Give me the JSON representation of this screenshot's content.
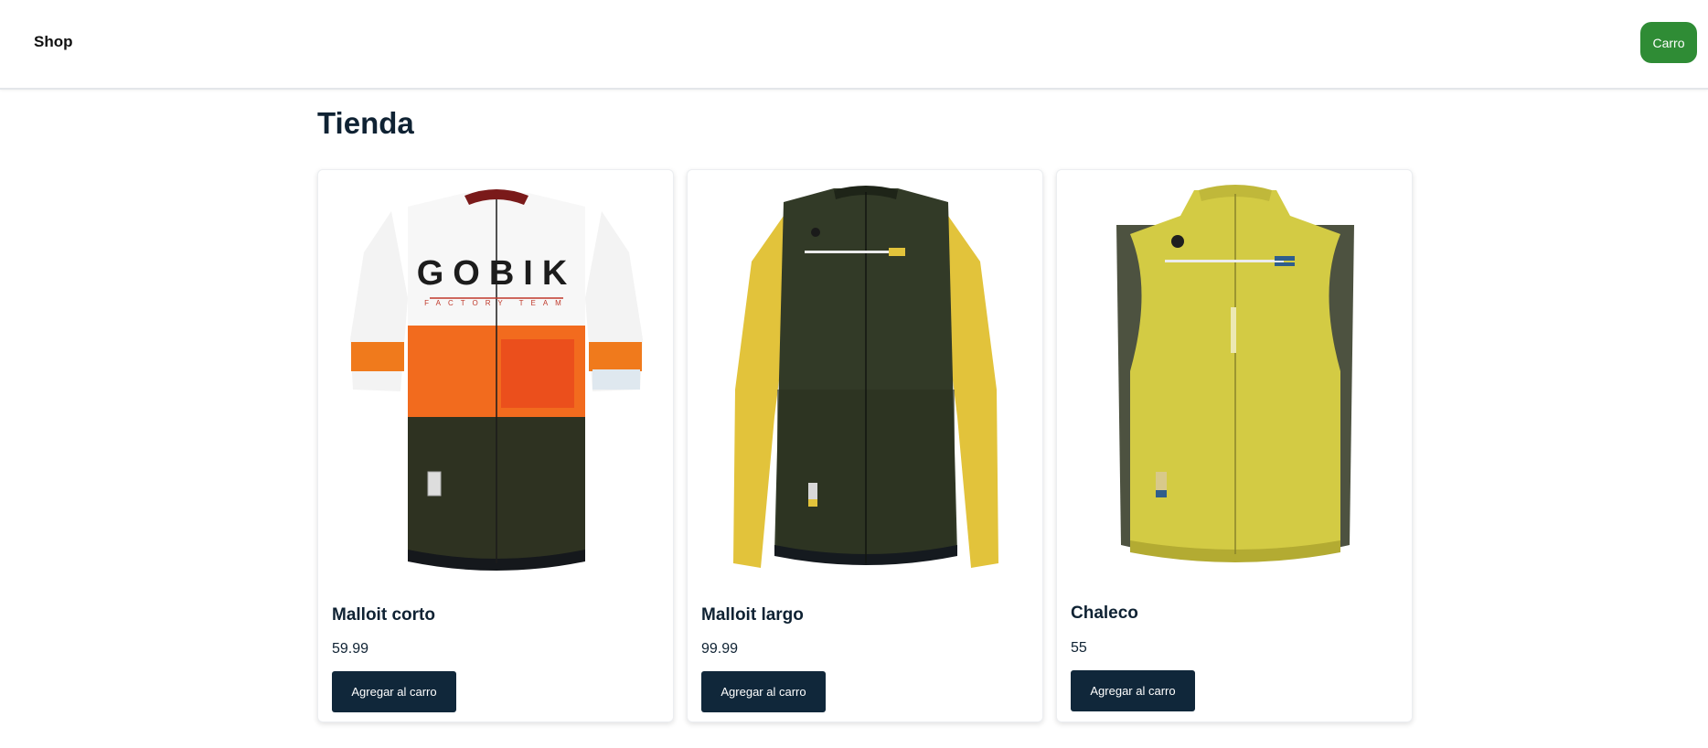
{
  "header": {
    "brand": "Shop",
    "cart_label": "Carro"
  },
  "main": {
    "title": "Tienda",
    "products": [
      {
        "name": "Malloit corto",
        "price": "59.99",
        "add_label": "Agregar al carro",
        "image": {
          "icon": "short-sleeve-jersey-image",
          "print": "GOBIK",
          "subprint": "FACTORY TEAM"
        }
      },
      {
        "name": "Malloit largo",
        "price": "99.99",
        "add_label": "Agregar al carro",
        "image": {
          "icon": "long-sleeve-jersey-image"
        }
      },
      {
        "name": "Chaleco",
        "price": "55",
        "add_label": "Agregar al carro",
        "image": {
          "icon": "vest-image"
        }
      }
    ]
  },
  "colors": {
    "cart_button": "#2f8c35",
    "add_button": "#10273a",
    "text": "#0f2233"
  }
}
